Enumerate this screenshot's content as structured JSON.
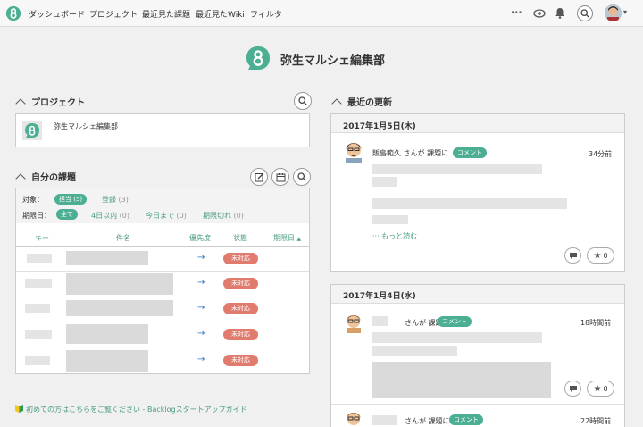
{
  "nav": {
    "items": [
      "ダッシュボード",
      "プロジェクト",
      "最近見た課題",
      "最近見たWiki",
      "フィルタ"
    ],
    "more": "···"
  },
  "space": {
    "title": "弥生マルシェ編集部"
  },
  "projects": {
    "heading": "プロジェクト",
    "items": [
      {
        "name": "弥生マルシェ編集部"
      }
    ]
  },
  "my_issues": {
    "heading": "自分の課題",
    "filter_target_label": "対象：",
    "filter_assigned": "担当",
    "filter_assigned_count": "(5)",
    "filter_registered": "登録",
    "filter_registered_count": "(3)",
    "filter_due_label": "期限日：",
    "filter_all": "全て",
    "filter_4days": "4日以内",
    "filter_4days_count": "(0)",
    "filter_today": "今日まで",
    "filter_today_count": "(0)",
    "filter_overdue": "期限切れ",
    "filter_overdue_count": "(0)",
    "columns": [
      "キー",
      "件名",
      "優先度",
      "状態",
      "期限日"
    ],
    "sort_indicator": "▲",
    "rows": [
      {
        "priority": "→",
        "status": "未対応"
      },
      {
        "priority": "→",
        "status": "未対応"
      },
      {
        "priority": "→",
        "status": "未対応"
      },
      {
        "priority": "→",
        "status": "未対応"
      },
      {
        "priority": "→",
        "status": "未対応"
      }
    ]
  },
  "recent_updates": {
    "heading": "最近の更新",
    "groups": [
      {
        "date": "2017年1月5日(木)",
        "entries": [
          {
            "user": "飯島範久",
            "action": "さんが 課題に",
            "tag": "コメント",
            "time": "34分前",
            "read_more": "··· もっと読む",
            "star_count": "0"
          }
        ]
      },
      {
        "date": "2017年1月4日(水)",
        "entries": [
          {
            "action": "さんが 課題に",
            "tag": "コメント",
            "time": "18時間前",
            "star_count": "0"
          },
          {
            "action": "さんが 課題に",
            "tag": "コメント",
            "time": "22時間前"
          }
        ]
      }
    ]
  },
  "footer": {
    "link": "初めての方はこちらをご覧ください - Backlogスタートアップガイド"
  },
  "colors": {
    "brand": "#4caf93",
    "status_open": "#e07b6e",
    "link": "#4a9c7e"
  }
}
